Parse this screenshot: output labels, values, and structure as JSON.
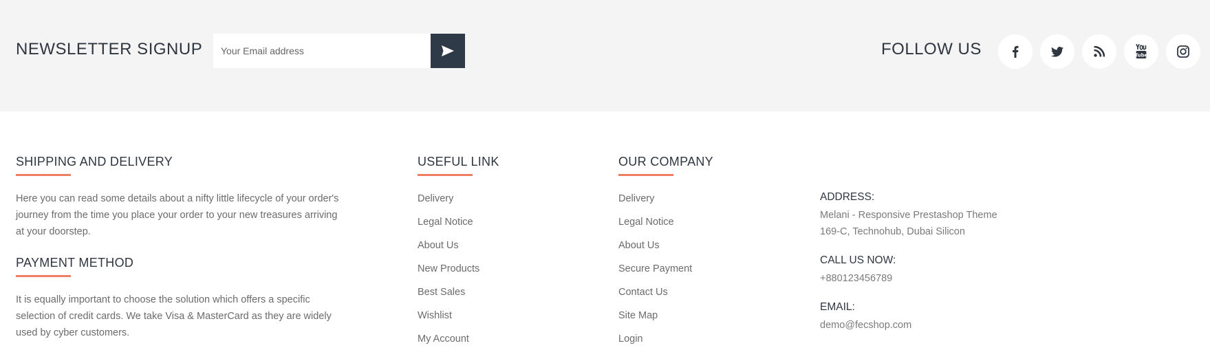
{
  "newsletter": {
    "title": "NEWSLETTER SIGNUP",
    "email_placeholder": "Your Email address",
    "submit_icon": "send-icon"
  },
  "follow": {
    "title": "FOLLOW US",
    "socials": [
      {
        "name": "facebook",
        "icon": "facebook-icon"
      },
      {
        "name": "twitter",
        "icon": "twitter-icon"
      },
      {
        "name": "rss",
        "icon": "rss-icon"
      },
      {
        "name": "youtube",
        "icon": "youtube-icon"
      },
      {
        "name": "instagram",
        "icon": "instagram-icon"
      }
    ]
  },
  "shipping": {
    "title": "SHIPPING AND DELIVERY",
    "text": "Here you can read some details about a nifty little lifecycle of your order's journey from the time you place your order to your new treasures arriving at your doorstep."
  },
  "payment": {
    "title": "PAYMENT METHOD",
    "text": "It is equally important to choose the solution which offers a specific selection of credit cards. We take Visa & MasterCard as they are widely used by cyber customers."
  },
  "useful_links": {
    "title": "USEFUL LINK",
    "items": [
      "Delivery",
      "Legal Notice",
      "About Us",
      "New Products",
      "Best Sales",
      "Wishlist",
      "My Account"
    ]
  },
  "our_company": {
    "title": "OUR COMPANY",
    "items": [
      "Delivery",
      "Legal Notice",
      "About Us",
      "Secure Payment",
      "Contact Us",
      "Site Map",
      "Login"
    ]
  },
  "contact": {
    "address_label": "ADDRESS:",
    "address_line1": "Melani - Responsive Prestashop Theme",
    "address_line2": "169-C, Technohub, Dubai Silicon",
    "phone_label": "CALL US NOW:",
    "phone": "+880123456789",
    "email_label": "EMAIL:",
    "email": "demo@fecshop.com"
  },
  "colors": {
    "accent": "#f07c61",
    "dark": "#2f3a48",
    "band": "#f4f4f4"
  }
}
